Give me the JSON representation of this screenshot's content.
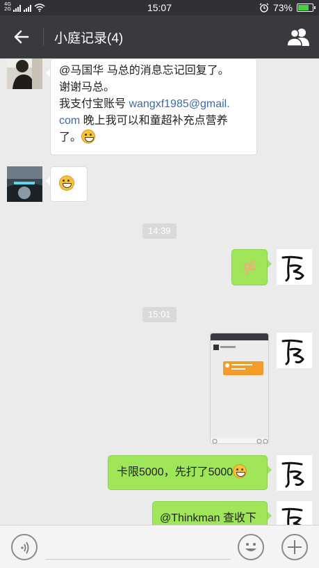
{
  "status": {
    "signal_left": "4G 2G",
    "time": "15:07",
    "battery_percent": "73%",
    "battery_level": 0.73,
    "icons": [
      "signal-icon",
      "wifi-icon",
      "alarm-icon",
      "battery-icon"
    ]
  },
  "header": {
    "title": "小庭记录(4)",
    "back_icon": "back-arrow-icon",
    "members_icon": "people-icon"
  },
  "messages": [
    {
      "side": "in",
      "avatar": "avatar-person",
      "line1": "@马国华 马总的消息忘记回复了。",
      "line2": "谢谢马总。",
      "line3_prefix": "我支付宝账号 ",
      "line3_link": "wangxf1985@gmail.",
      "line4_link": "com",
      "line4_suffix": " 晚上我可以和童超补充点营养",
      "line5": "了。",
      "emoji": "grin-emoji"
    },
    {
      "side": "in",
      "avatar": "avatar-car",
      "emoji": "grin-emoji"
    },
    {
      "timestamp": "14:39"
    },
    {
      "side": "out",
      "avatar": "avatar-calligraphy",
      "emoji": "ok-hand-emoji"
    },
    {
      "timestamp": "15:01"
    },
    {
      "side": "out",
      "avatar": "avatar-calligraphy",
      "image": "screenshot-thumbnail"
    },
    {
      "side": "out",
      "avatar": "avatar-calligraphy",
      "text": "卡限5000，先打了5000",
      "emoji": "grin-emoji"
    },
    {
      "side": "out",
      "avatar": "avatar-calligraphy",
      "text": "@Thinkman 查收下"
    }
  ],
  "inputbar": {
    "voice_icon": "voice-icon",
    "emoji_icon": "smiley-icon",
    "plus_icon": "plus-icon"
  }
}
